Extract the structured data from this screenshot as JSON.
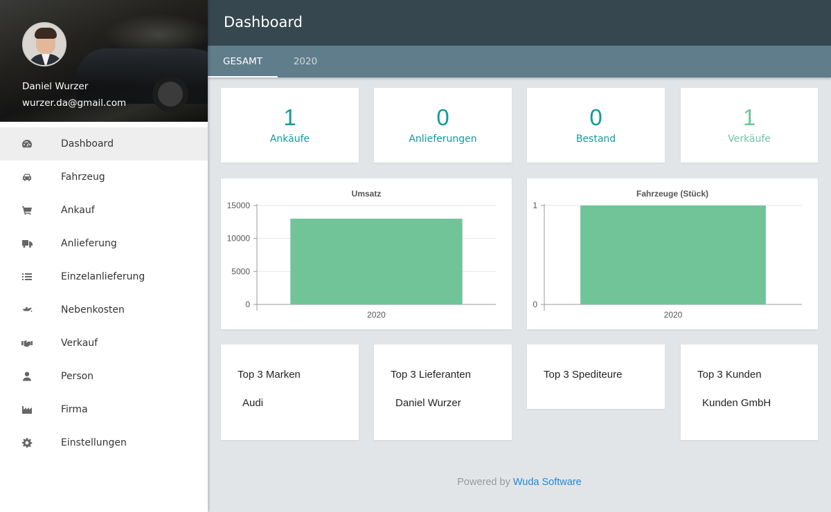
{
  "profile": {
    "name": "Daniel Wurzer",
    "email": "wurzer.da@gmail.com"
  },
  "nav": [
    {
      "label": "Dashboard",
      "icon": "dashboard-icon",
      "active": true
    },
    {
      "label": "Fahrzeug",
      "icon": "car-icon"
    },
    {
      "label": "Ankauf",
      "icon": "cart-icon"
    },
    {
      "label": "Anlieferung",
      "icon": "truck-icon"
    },
    {
      "label": "Einzelanlieferung",
      "icon": "list-icon"
    },
    {
      "label": "Nebenkosten",
      "icon": "oil-can-icon"
    },
    {
      "label": "Verkauf",
      "icon": "handshake-icon"
    },
    {
      "label": "Person",
      "icon": "person-icon"
    },
    {
      "label": "Firma",
      "icon": "factory-icon"
    },
    {
      "label": "Einstellungen",
      "icon": "gear-icon"
    }
  ],
  "header": {
    "title": "Dashboard"
  },
  "tabs": [
    {
      "label": "GESAMT",
      "active": true
    },
    {
      "label": "2020"
    }
  ],
  "stats": [
    {
      "value": "1",
      "label": "Ankäufe",
      "color": "#139a9b"
    },
    {
      "value": "0",
      "label": "Anlieferungen",
      "color": "#139a9b"
    },
    {
      "value": "0",
      "label": "Bestand",
      "color": "#139a9b"
    },
    {
      "value": "1",
      "label": "Verkäufe",
      "color": "#6cc5a0"
    }
  ],
  "chart_data": [
    {
      "type": "bar",
      "title": "Umsatz",
      "categories": [
        "2020"
      ],
      "values": [
        13000
      ],
      "ylim": [
        0,
        15000
      ],
      "yticks": [
        "0",
        "5000",
        "10000",
        "15000"
      ],
      "color": "#70c498",
      "grid": true
    },
    {
      "type": "bar",
      "title": "Fahrzeuge (Stück)",
      "categories": [
        "2020"
      ],
      "values": [
        1
      ],
      "ylim": [
        0,
        1
      ],
      "yticks": [
        "0",
        "1"
      ],
      "color": "#70c498",
      "grid": true
    }
  ],
  "top3": [
    {
      "title": "Top 3 Marken",
      "items": [
        "Audi"
      ]
    },
    {
      "title": "Top 3 Lieferanten",
      "items": [
        "Daniel Wurzer"
      ]
    },
    {
      "title": "Top 3 Spediteure",
      "items": []
    },
    {
      "title": "Top 3 Kunden",
      "items": [
        "Kunden GmbH"
      ]
    }
  ],
  "footer": {
    "prefix": "Powered by",
    "link": "Wuda Software"
  }
}
